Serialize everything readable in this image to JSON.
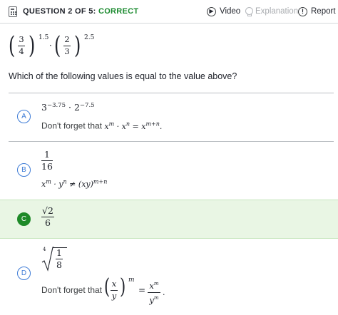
{
  "header": {
    "question_prefix": "QUESTION 2 OF 5:",
    "status": "CORRECT",
    "video_label": "Video",
    "explanation_label": "Explanation",
    "report_label": "Report"
  },
  "question": {
    "expression": {
      "frac1_num": "3",
      "frac1_den": "4",
      "exp1": "1.5",
      "dot": "·",
      "frac2_num": "2",
      "frac2_den": "3",
      "exp2": "2.5"
    },
    "prompt": "Which of the following values is equal to the value above?"
  },
  "choices": [
    {
      "letter": "A",
      "math": {
        "b1": "3",
        "e1": "−3.75",
        "dot": "·",
        "b2": "2",
        "e2": "−7.5"
      },
      "hint_prefix": "Don't forget that",
      "hint_math": "x^m · x^n = x^(m+n)."
    },
    {
      "letter": "B",
      "math": {
        "num": "1",
        "den": "16"
      },
      "hint_math": "x^m · y^n ≠ (xy)^(m+n)"
    },
    {
      "letter": "C",
      "selected": true,
      "math": {
        "num": "√2",
        "den": "6"
      }
    },
    {
      "letter": "D",
      "math": {
        "index": "4",
        "num": "1",
        "den": "8"
      },
      "hint_prefix": "Don't forget that",
      "hint_math": "(x/y)^m = x^m/y^m."
    }
  ],
  "colors": {
    "correct_green": "#1a8a2e",
    "selected_bg": "#e9f6e4",
    "accent_blue": "#3d7bd6"
  }
}
